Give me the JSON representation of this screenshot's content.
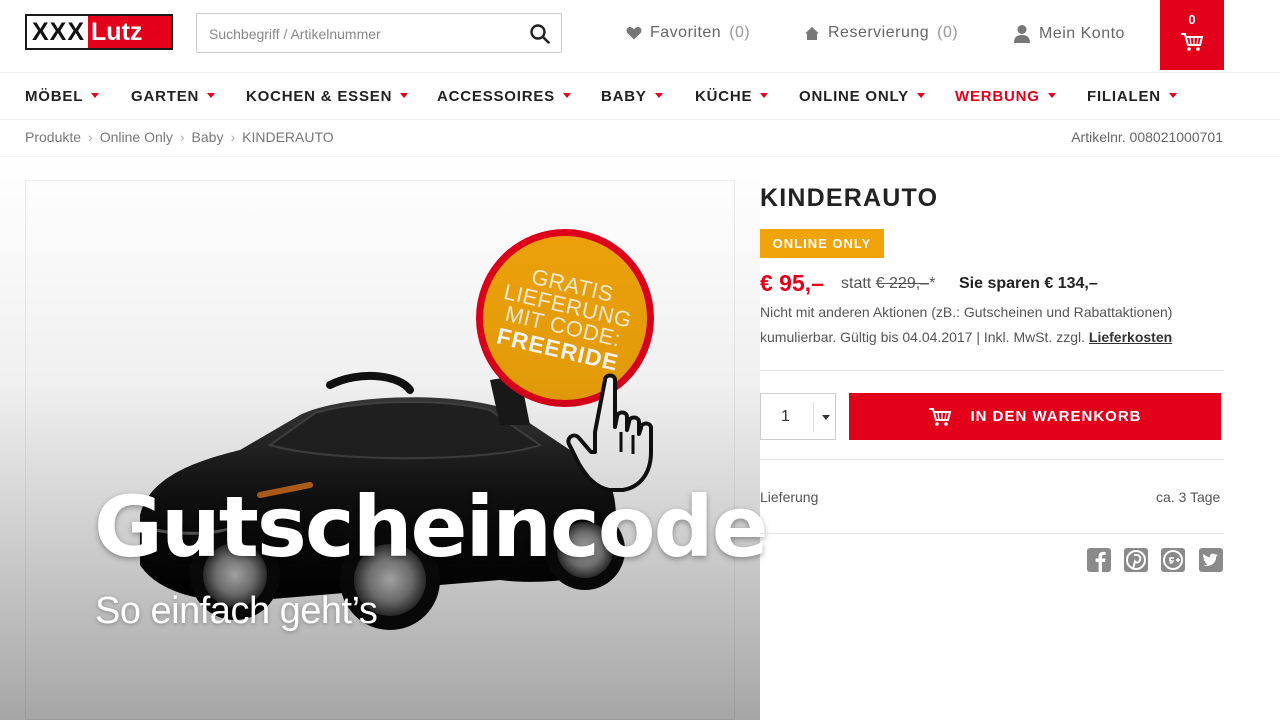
{
  "header": {
    "logo": {
      "part1": "XXX",
      "part2": "Lutz"
    },
    "search": {
      "placeholder": "Suchbegriff / Artikelnummer"
    },
    "favoriten": {
      "label": "Favoriten",
      "count": "(0)"
    },
    "reservierung": {
      "label": "Reservierung",
      "count": "(0)"
    },
    "konto": {
      "label": "Mein Konto"
    },
    "cart": {
      "count": "0"
    }
  },
  "nav": {
    "items": [
      {
        "label": "MÖBEL"
      },
      {
        "label": "GARTEN"
      },
      {
        "label": "KOCHEN & ESSEN"
      },
      {
        "label": "ACCESSOIRES"
      },
      {
        "label": "BABY"
      },
      {
        "label": "KÜCHE"
      },
      {
        "label": "ONLINE ONLY"
      },
      {
        "label": "WERBUNG"
      },
      {
        "label": "FILIALEN"
      }
    ]
  },
  "breadcrumb": {
    "items": [
      "Produkte",
      "Online Only",
      "Baby",
      "KINDERAUTO"
    ],
    "separator": "›"
  },
  "product": {
    "artnr": "Artikelnr. 008021000701",
    "title": "KINDERAUTO",
    "badge": "ONLINE ONLY",
    "price": "€ 95,–",
    "statt_label": "statt",
    "old_price": "€ 229,–",
    "old_price_suffix": "*",
    "save": "Sie sparen € 134,–",
    "note1": "Nicht mit anderen Aktionen (zB.: Gutscheinen und Rabattaktionen)",
    "note2": "kumulierbar. Gültig bis 04.04.2017 | Inkl. MwSt. zzgl.",
    "lieferkosten": "Lieferkosten",
    "quantity": "1",
    "add_to_cart": "IN DEN WARENKORB",
    "lieferung_label": "Lieferung",
    "lieferung_value": "ca. 3 Tage"
  },
  "promo_badge": {
    "lines": [
      "GRATIS",
      "LIEFERUNG",
      "MIT CODE:"
    ],
    "code": "FREERIDE"
  },
  "overlay": {
    "headline": "Gutscheincode",
    "subline": "So einfach geht’s"
  },
  "social": [
    "facebook-icon",
    "pinterest-icon",
    "google-plus-icon",
    "twitter-icon"
  ],
  "colors": {
    "brand_red": "#e3001b",
    "accent_orange": "#f0a40a"
  }
}
